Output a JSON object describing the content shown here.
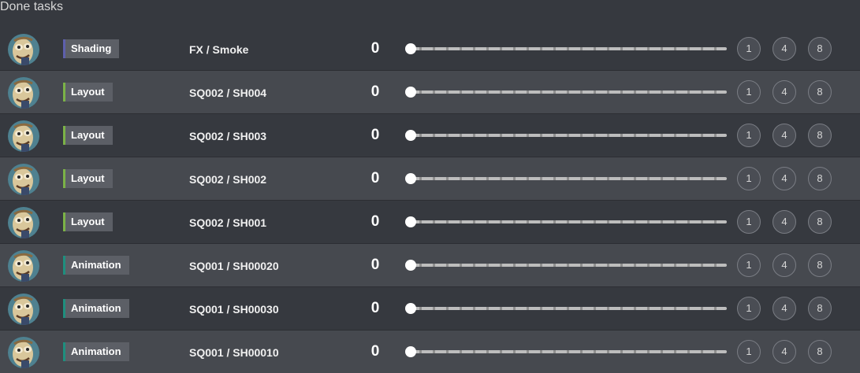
{
  "header": {
    "title": "Done tasks"
  },
  "colors": {
    "shading": "#5e60ad",
    "layout": "#7bb247",
    "animation": "#1e8f7e"
  },
  "rows": [
    {
      "task_type": "Shading",
      "task_color": "#5e60ad",
      "entity": "FX / Smoke",
      "count": "0",
      "progress": 0,
      "zoom": [
        "1",
        "4",
        "8"
      ]
    },
    {
      "task_type": "Layout",
      "task_color": "#7bb247",
      "entity": "SQ002 / SH004",
      "count": "0",
      "progress": 0,
      "zoom": [
        "1",
        "4",
        "8"
      ]
    },
    {
      "task_type": "Layout",
      "task_color": "#7bb247",
      "entity": "SQ002 / SH003",
      "count": "0",
      "progress": 0,
      "zoom": [
        "1",
        "4",
        "8"
      ]
    },
    {
      "task_type": "Layout",
      "task_color": "#7bb247",
      "entity": "SQ002 / SH002",
      "count": "0",
      "progress": 0,
      "zoom": [
        "1",
        "4",
        "8"
      ]
    },
    {
      "task_type": "Layout",
      "task_color": "#7bb247",
      "entity": "SQ002 / SH001",
      "count": "0",
      "progress": 0,
      "zoom": [
        "1",
        "4",
        "8"
      ]
    },
    {
      "task_type": "Animation",
      "task_color": "#1e8f7e",
      "entity": "SQ001 / SH00020",
      "count": "0",
      "progress": 0,
      "zoom": [
        "1",
        "4",
        "8"
      ]
    },
    {
      "task_type": "Animation",
      "task_color": "#1e8f7e",
      "entity": "SQ001 / SH00030",
      "count": "0",
      "progress": 0,
      "zoom": [
        "1",
        "4",
        "8"
      ]
    },
    {
      "task_type": "Animation",
      "task_color": "#1e8f7e",
      "entity": "SQ001 / SH00010",
      "count": "0",
      "progress": 0,
      "zoom": [
        "1",
        "4",
        "8"
      ]
    }
  ]
}
